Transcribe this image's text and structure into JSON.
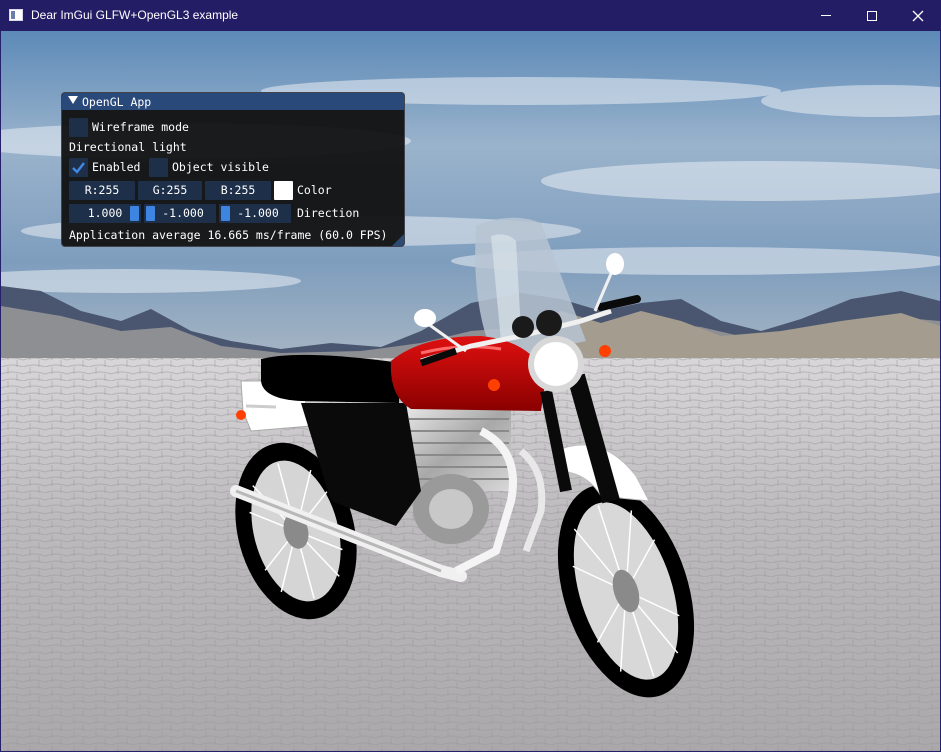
{
  "window": {
    "title": "Dear ImGui GLFW+OpenGL3 example",
    "controls": {
      "minimize": "minimize",
      "maximize": "maximize",
      "close": "✕"
    }
  },
  "imgui": {
    "title": "OpenGL App",
    "wireframe": {
      "label": "Wireframe mode",
      "checked": false
    },
    "section_label": "Directional light",
    "enabled": {
      "label": "Enabled",
      "checked": true
    },
    "object_visible": {
      "label": "Object visible",
      "checked": false
    },
    "color": {
      "r": "R:255",
      "g": "G:255",
      "b": "B:255",
      "label": "Color",
      "swatch": "#ffffff"
    },
    "direction": {
      "values": [
        "1.000",
        "-1.000",
        "-1.000"
      ],
      "fractions": [
        1.0,
        0.0,
        0.0
      ],
      "label": "Direction"
    },
    "fps_text": "Application average 16.665 ms/frame (60.0 FPS)"
  },
  "scene": {
    "description_icon": "motorcycle-3d-model",
    "sky_color": "#7d9fc4",
    "ground_color": "#c4c2c4",
    "bike_tank_color": "#c80000",
    "indicator_color": "#ff4000"
  }
}
